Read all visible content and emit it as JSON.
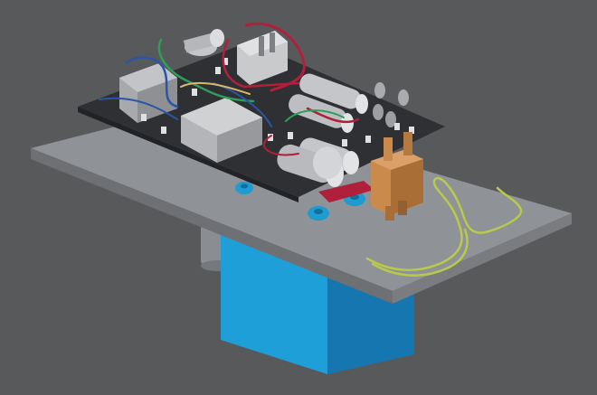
{
  "scene": {
    "kind": "3d-cad-render",
    "background": "#58595b",
    "colors": {
      "base_plate": "#8f9296",
      "base_plate_edge": "#6e7074",
      "pcb": "#2f3033",
      "blue_box": "#1f9fd8",
      "blue_box_side": "#1677b0",
      "teal_ring": "#1e9bd0",
      "bronze_part": "#c98a4b",
      "yellow_wire": "#b9c94a",
      "red_wire": "#b0203a",
      "green_wire": "#2e9e5a",
      "blue_wire": "#2a55a8",
      "capacitor": "#c4c6c9",
      "motor": "#8a8d91"
    },
    "components": [
      "base-plate",
      "circuit-board",
      "transformer-left",
      "transformer-center",
      "capacitor-row",
      "relay-block",
      "bronze-connector",
      "toroid-rings",
      "yellow-wire-loop",
      "blue-housing",
      "motor-cylinder"
    ]
  }
}
